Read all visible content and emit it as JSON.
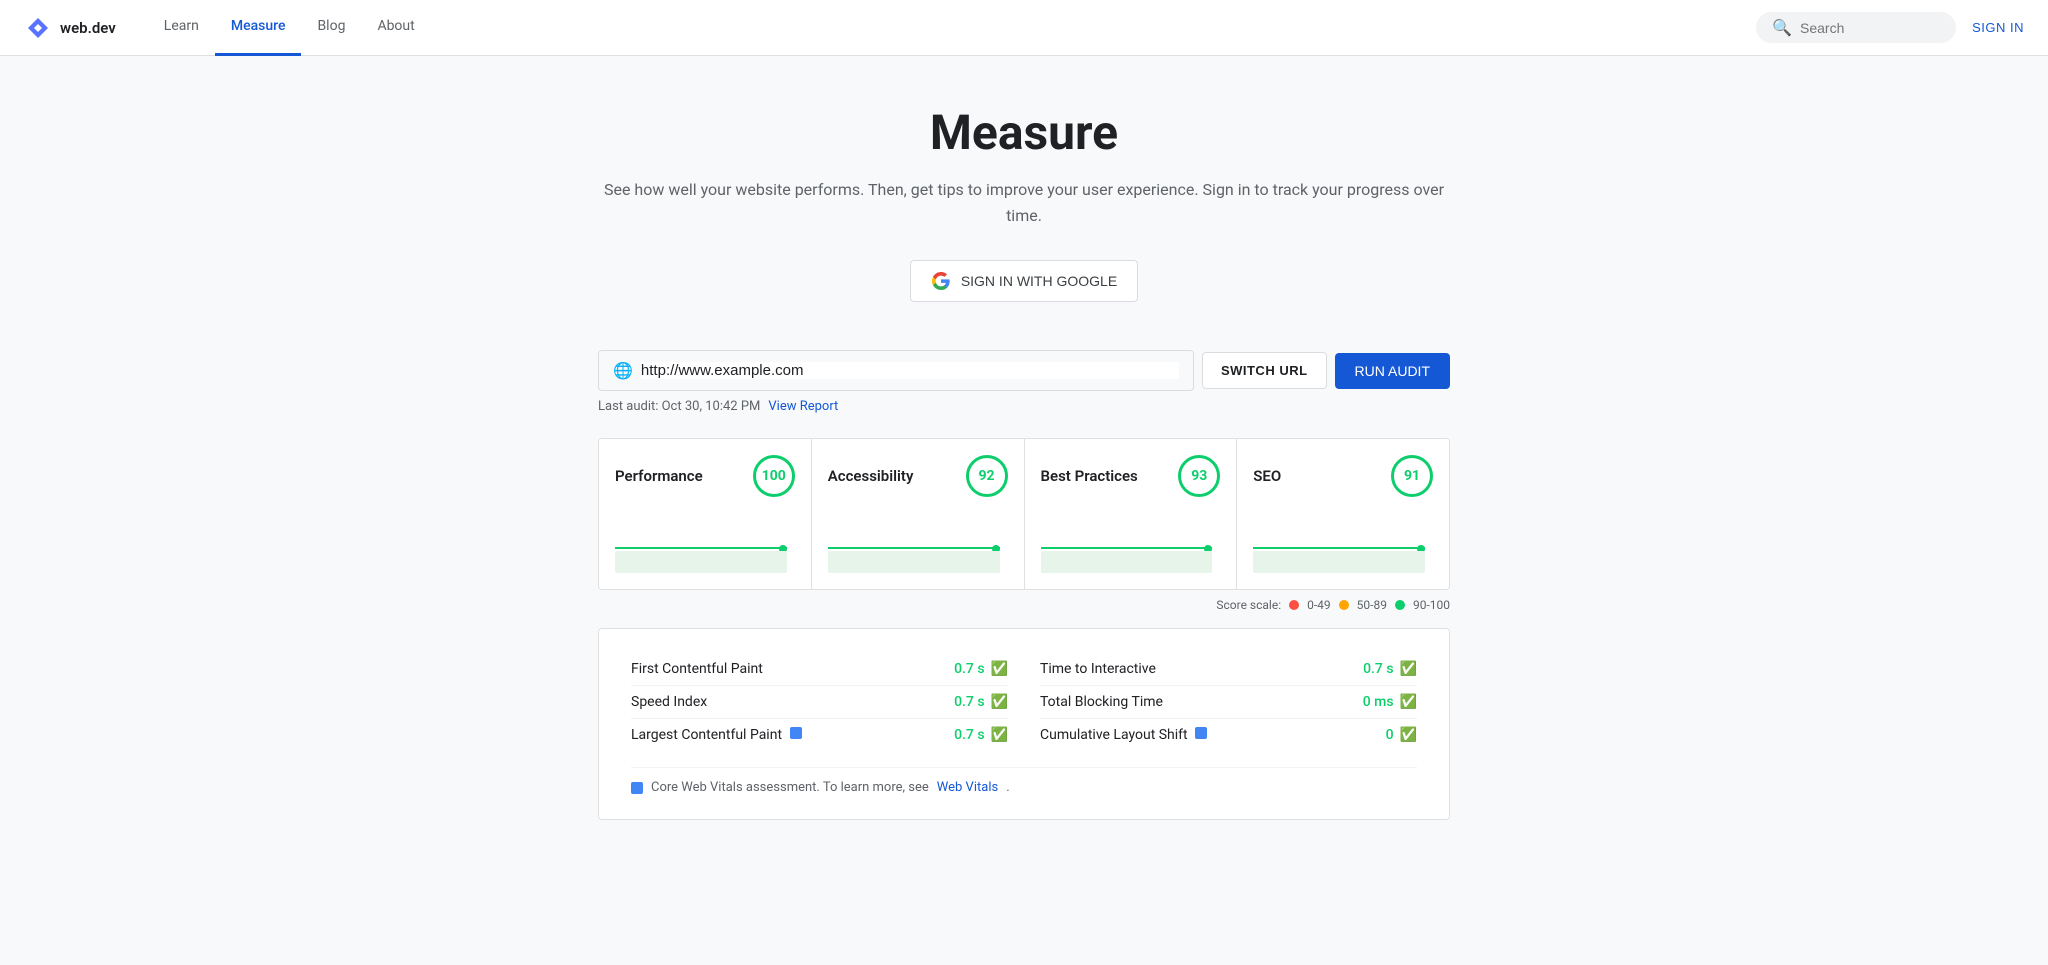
{
  "nav": {
    "logo_text": "web.dev",
    "links": [
      {
        "label": "Learn",
        "active": false
      },
      {
        "label": "Measure",
        "active": true
      },
      {
        "label": "Blog",
        "active": false
      },
      {
        "label": "About",
        "active": false
      }
    ],
    "search_placeholder": "Search",
    "sign_in_label": "SIGN IN"
  },
  "hero": {
    "title": "Measure",
    "subtitle": "See how well your website performs. Then, get tips to improve your user\nexperience. Sign in to track your progress over time.",
    "google_btn_label": "SIGN IN WITH GOOGLE"
  },
  "url_bar": {
    "url_value": "http://www.example.com",
    "switch_url_label": "SWITCH URL",
    "run_audit_label": "RUN AUDIT",
    "last_audit_text": "Last audit: Oct 30, 10:42 PM",
    "view_report_label": "View Report"
  },
  "score_cards": [
    {
      "name": "Performance",
      "score": 100
    },
    {
      "name": "Accessibility",
      "score": 92
    },
    {
      "name": "Best Practices",
      "score": 93
    },
    {
      "name": "SEO",
      "score": 91
    }
  ],
  "score_scale": {
    "label": "Score scale:",
    "ranges": [
      {
        "label": "0-49",
        "color": "#ff4e42"
      },
      {
        "label": "50-89",
        "color": "#ffa400"
      },
      {
        "label": "90-100",
        "color": "#0cce6b"
      }
    ]
  },
  "metrics": {
    "left": [
      {
        "name": "First Contentful Paint",
        "value": "0.7 s",
        "cwv": false
      },
      {
        "name": "Speed Index",
        "value": "0.7 s",
        "cwv": false
      },
      {
        "name": "Largest Contentful Paint",
        "value": "0.7 s",
        "cwv": true
      }
    ],
    "right": [
      {
        "name": "Time to Interactive",
        "value": "0.7 s",
        "cwv": false
      },
      {
        "name": "Total Blocking Time",
        "value": "0 ms",
        "cwv": false
      },
      {
        "name": "Cumulative Layout Shift",
        "value": "0",
        "cwv": true
      }
    ]
  },
  "cwv_note": {
    "text": "Core Web Vitals assessment. To learn more, see",
    "link_label": "Web Vitals",
    "link_suffix": "."
  }
}
